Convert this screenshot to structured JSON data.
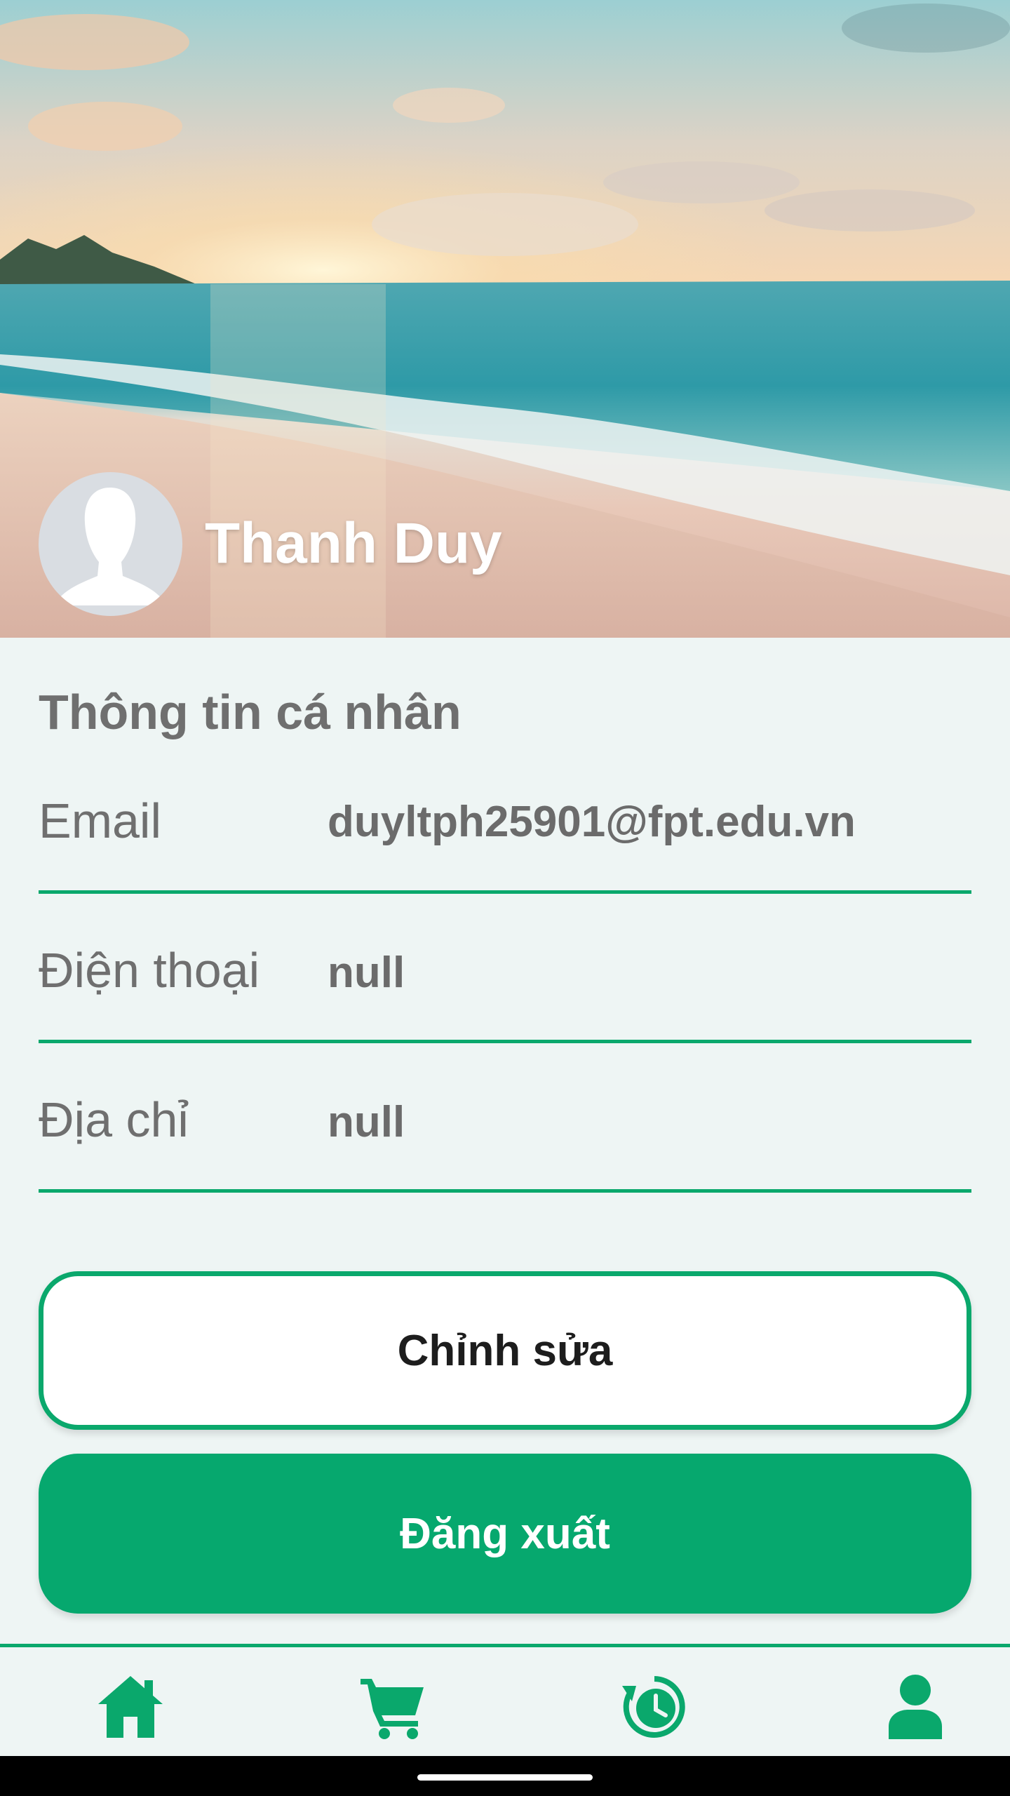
{
  "profile": {
    "name": "Thanh Duy"
  },
  "info": {
    "section_title": "Thông tin cá nhân",
    "rows": [
      {
        "label": "Email",
        "value": "duyltph25901@fpt.edu.vn"
      },
      {
        "label": "Điện thoại",
        "value": "null"
      },
      {
        "label": "Địa chỉ",
        "value": "null"
      }
    ]
  },
  "buttons": {
    "edit_label": "Chỉnh sửa",
    "logout_label": "Đăng xuất"
  },
  "nav": {
    "items": [
      {
        "icon": "home-icon"
      },
      {
        "icon": "cart-icon"
      },
      {
        "icon": "history-icon"
      },
      {
        "icon": "profile-icon"
      }
    ]
  },
  "colors": {
    "accent": "#0aa86c",
    "background": "#eef5f4",
    "text_gray": "#6f6f6f"
  }
}
